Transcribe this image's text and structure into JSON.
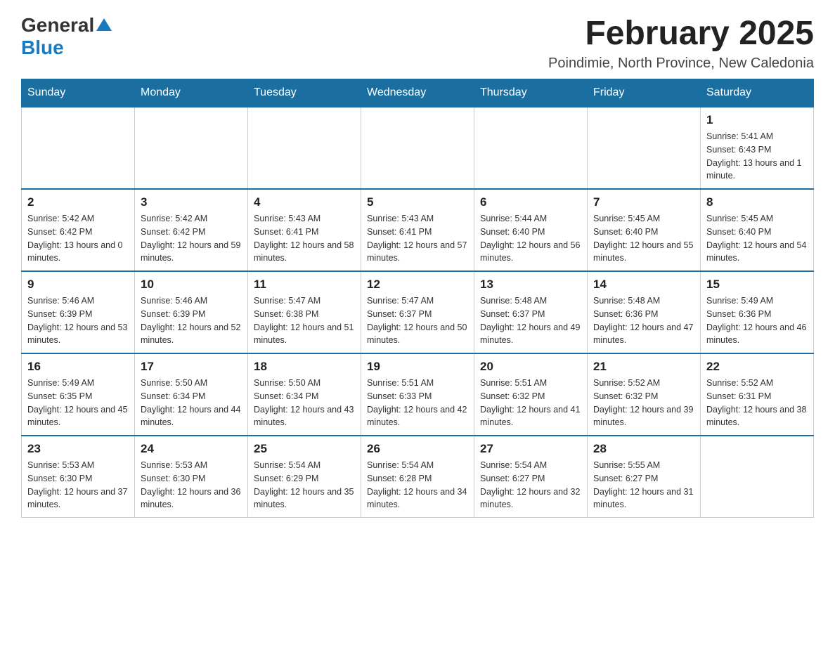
{
  "header": {
    "logo_general": "General",
    "logo_blue": "Blue",
    "title": "February 2025",
    "subtitle": "Poindimie, North Province, New Caledonia"
  },
  "days_of_week": [
    "Sunday",
    "Monday",
    "Tuesday",
    "Wednesday",
    "Thursday",
    "Friday",
    "Saturday"
  ],
  "weeks": [
    [
      {
        "day": "",
        "info": ""
      },
      {
        "day": "",
        "info": ""
      },
      {
        "day": "",
        "info": ""
      },
      {
        "day": "",
        "info": ""
      },
      {
        "day": "",
        "info": ""
      },
      {
        "day": "",
        "info": ""
      },
      {
        "day": "1",
        "info": "Sunrise: 5:41 AM\nSunset: 6:43 PM\nDaylight: 13 hours and 1 minute."
      }
    ],
    [
      {
        "day": "2",
        "info": "Sunrise: 5:42 AM\nSunset: 6:42 PM\nDaylight: 13 hours and 0 minutes."
      },
      {
        "day": "3",
        "info": "Sunrise: 5:42 AM\nSunset: 6:42 PM\nDaylight: 12 hours and 59 minutes."
      },
      {
        "day": "4",
        "info": "Sunrise: 5:43 AM\nSunset: 6:41 PM\nDaylight: 12 hours and 58 minutes."
      },
      {
        "day": "5",
        "info": "Sunrise: 5:43 AM\nSunset: 6:41 PM\nDaylight: 12 hours and 57 minutes."
      },
      {
        "day": "6",
        "info": "Sunrise: 5:44 AM\nSunset: 6:40 PM\nDaylight: 12 hours and 56 minutes."
      },
      {
        "day": "7",
        "info": "Sunrise: 5:45 AM\nSunset: 6:40 PM\nDaylight: 12 hours and 55 minutes."
      },
      {
        "day": "8",
        "info": "Sunrise: 5:45 AM\nSunset: 6:40 PM\nDaylight: 12 hours and 54 minutes."
      }
    ],
    [
      {
        "day": "9",
        "info": "Sunrise: 5:46 AM\nSunset: 6:39 PM\nDaylight: 12 hours and 53 minutes."
      },
      {
        "day": "10",
        "info": "Sunrise: 5:46 AM\nSunset: 6:39 PM\nDaylight: 12 hours and 52 minutes."
      },
      {
        "day": "11",
        "info": "Sunrise: 5:47 AM\nSunset: 6:38 PM\nDaylight: 12 hours and 51 minutes."
      },
      {
        "day": "12",
        "info": "Sunrise: 5:47 AM\nSunset: 6:37 PM\nDaylight: 12 hours and 50 minutes."
      },
      {
        "day": "13",
        "info": "Sunrise: 5:48 AM\nSunset: 6:37 PM\nDaylight: 12 hours and 49 minutes."
      },
      {
        "day": "14",
        "info": "Sunrise: 5:48 AM\nSunset: 6:36 PM\nDaylight: 12 hours and 47 minutes."
      },
      {
        "day": "15",
        "info": "Sunrise: 5:49 AM\nSunset: 6:36 PM\nDaylight: 12 hours and 46 minutes."
      }
    ],
    [
      {
        "day": "16",
        "info": "Sunrise: 5:49 AM\nSunset: 6:35 PM\nDaylight: 12 hours and 45 minutes."
      },
      {
        "day": "17",
        "info": "Sunrise: 5:50 AM\nSunset: 6:34 PM\nDaylight: 12 hours and 44 minutes."
      },
      {
        "day": "18",
        "info": "Sunrise: 5:50 AM\nSunset: 6:34 PM\nDaylight: 12 hours and 43 minutes."
      },
      {
        "day": "19",
        "info": "Sunrise: 5:51 AM\nSunset: 6:33 PM\nDaylight: 12 hours and 42 minutes."
      },
      {
        "day": "20",
        "info": "Sunrise: 5:51 AM\nSunset: 6:32 PM\nDaylight: 12 hours and 41 minutes."
      },
      {
        "day": "21",
        "info": "Sunrise: 5:52 AM\nSunset: 6:32 PM\nDaylight: 12 hours and 39 minutes."
      },
      {
        "day": "22",
        "info": "Sunrise: 5:52 AM\nSunset: 6:31 PM\nDaylight: 12 hours and 38 minutes."
      }
    ],
    [
      {
        "day": "23",
        "info": "Sunrise: 5:53 AM\nSunset: 6:30 PM\nDaylight: 12 hours and 37 minutes."
      },
      {
        "day": "24",
        "info": "Sunrise: 5:53 AM\nSunset: 6:30 PM\nDaylight: 12 hours and 36 minutes."
      },
      {
        "day": "25",
        "info": "Sunrise: 5:54 AM\nSunset: 6:29 PM\nDaylight: 12 hours and 35 minutes."
      },
      {
        "day": "26",
        "info": "Sunrise: 5:54 AM\nSunset: 6:28 PM\nDaylight: 12 hours and 34 minutes."
      },
      {
        "day": "27",
        "info": "Sunrise: 5:54 AM\nSunset: 6:27 PM\nDaylight: 12 hours and 32 minutes."
      },
      {
        "day": "28",
        "info": "Sunrise: 5:55 AM\nSunset: 6:27 PM\nDaylight: 12 hours and 31 minutes."
      },
      {
        "day": "",
        "info": ""
      }
    ]
  ]
}
